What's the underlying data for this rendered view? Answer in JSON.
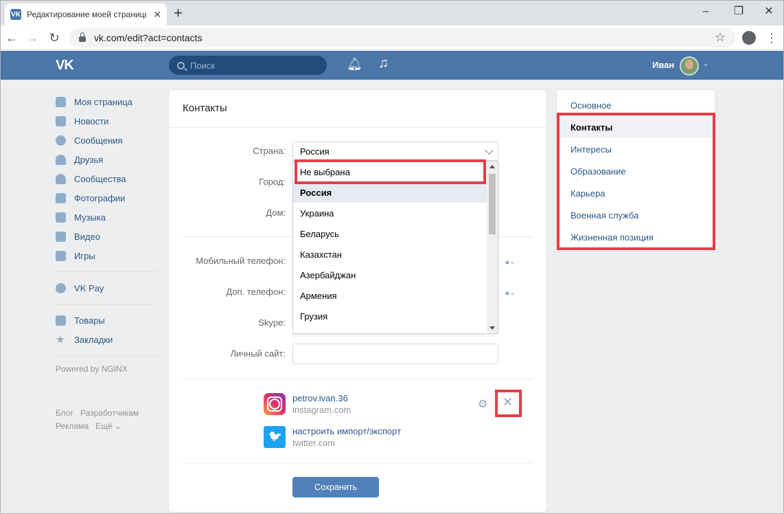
{
  "browser": {
    "tab_title": "Редактирование моей страницы",
    "url": "vk.com/edit?act=contacts"
  },
  "header": {
    "search_placeholder": "Поиск",
    "user_name": "Иван"
  },
  "left_menu": {
    "items": [
      {
        "label": "Моя страница",
        "icon": "home-icon"
      },
      {
        "label": "Новости",
        "icon": "news-icon"
      },
      {
        "label": "Сообщения",
        "icon": "messages-icon"
      },
      {
        "label": "Друзья",
        "icon": "friends-icon"
      },
      {
        "label": "Сообщества",
        "icon": "communities-icon"
      },
      {
        "label": "Фотографии",
        "icon": "camera-icon"
      },
      {
        "label": "Музыка",
        "icon": "music-icon"
      },
      {
        "label": "Видео",
        "icon": "video-icon"
      },
      {
        "label": "Игры",
        "icon": "games-icon"
      }
    ],
    "vkpay": "VK Pay",
    "goods": "Товары",
    "bookmarks": "Закладки",
    "powered": "Powered by NGINX",
    "footer": {
      "blog": "Блог",
      "dev": "Разработчикам",
      "ads": "Реклама",
      "more": "Ещё ⌄"
    }
  },
  "form": {
    "title": "Контакты",
    "country_label": "Страна:",
    "country_value": "Россия",
    "city_label": "Город:",
    "home_label": "Дом:",
    "mobile_label": "Мобильный телефон:",
    "alt_phone_label": "Доп. телефон:",
    "skype_label": "Skype:",
    "site_label": "Личный сайт:",
    "dropdown_options": [
      "Не выбрана",
      "Россия",
      "Украина",
      "Беларусь",
      "Казахстан",
      "Азербайджан",
      "Армения",
      "Грузия"
    ],
    "dropdown_selected_index": 1,
    "instagram": {
      "name": "petrov.ivan.36",
      "sub": "instagram.com"
    },
    "twitter": {
      "name": "настроить импорт/экспорт",
      "sub": "twitter.com"
    },
    "save_label": "Сохранить"
  },
  "right_menu": {
    "items": [
      "Основное",
      "Контакты",
      "Интересы",
      "Образование",
      "Карьера",
      "Военная служба",
      "Жизненная позиция"
    ],
    "active_index": 1
  },
  "colors": {
    "brand": "#4a76a8",
    "link": "#2a5885",
    "highlight": "#e53e46",
    "button": "#5181b8"
  }
}
